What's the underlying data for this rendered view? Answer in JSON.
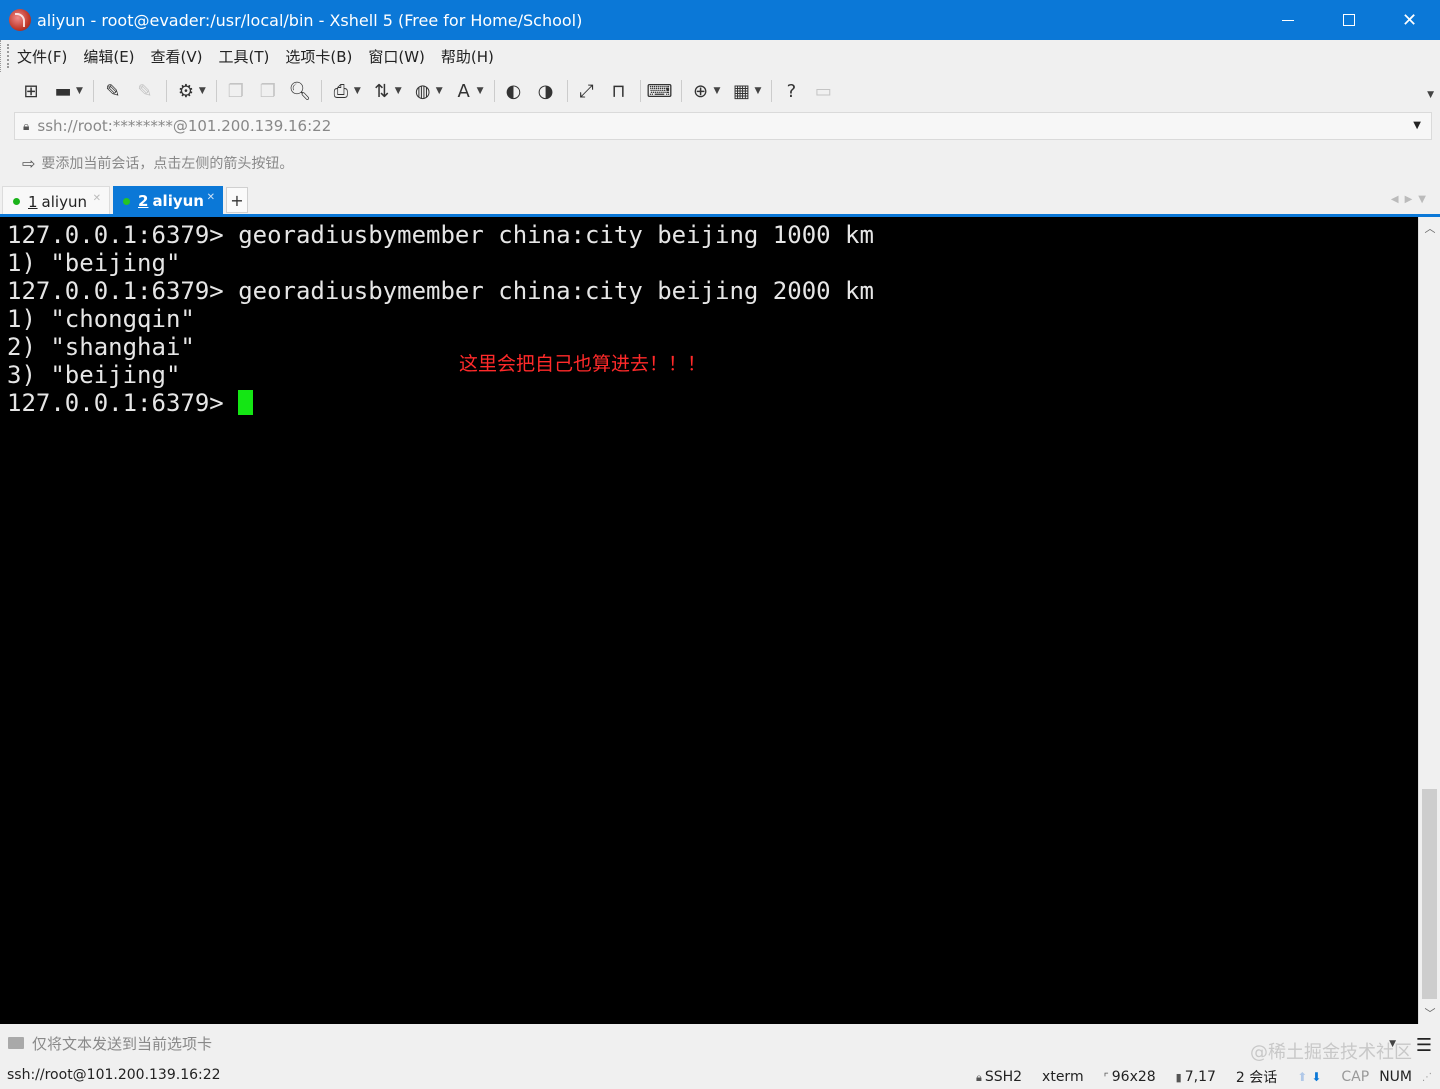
{
  "window": {
    "title": "aliyun - root@evader:/usr/local/bin - Xshell 5 (Free for Home/School)",
    "controls": {
      "minimize": "minimize",
      "maximize": "maximize",
      "close": "✕"
    }
  },
  "menu": [
    "文件(F)",
    "编辑(E)",
    "查看(V)",
    "工具(T)",
    "选项卡(B)",
    "窗口(W)",
    "帮助(H)"
  ],
  "toolbar": {
    "icons": [
      "new-session-icon",
      "open-folder-icon",
      "reconnect-icon",
      "disconnect-icon",
      "properties-icon",
      "copy-icon",
      "paste-icon",
      "find-icon",
      "print-icon",
      "transfer-icon",
      "globe-icon",
      "font-icon",
      "xftp-icon",
      "scripts-icon",
      "fullscreen-icon",
      "lock-icon",
      "keyboard-icon",
      "new-tab-icon",
      "layout-icon",
      "help-icon",
      "chat-icon"
    ]
  },
  "address": {
    "url": "ssh://root:********@101.200.139.16:22"
  },
  "hint": {
    "text": "要添加当前会话，点击左侧的箭头按钮。"
  },
  "tabs": [
    {
      "num": "1",
      "label": "aliyun",
      "active": false
    },
    {
      "num": "2",
      "label": "aliyun",
      "active": true
    }
  ],
  "tab_add": "+",
  "terminal": {
    "lines": [
      "127.0.0.1:6379> georadiusbymember china:city beijing 1000 km",
      "1) \"beijing\"",
      "127.0.0.1:6379> georadiusbymember china:city beijing 2000 km",
      "1) \"chongqin\"",
      "2) \"shanghai\"",
      "3) \"beijing\"",
      "127.0.0.1:6379> "
    ],
    "annotation": "这里会把自己也算进去！！！",
    "cursor_color": "#14e614",
    "background": "#000000"
  },
  "compose": {
    "text": "仅将文本发送到当前选项卡"
  },
  "watermark": "@稀土掘金技术社区",
  "status": {
    "connection": "ssh://root@101.200.139.16:22",
    "protocol": "SSH2",
    "terminal_type": "xterm",
    "size": "96x28",
    "position": "7,17",
    "sessions": "2 会话",
    "caps": "CAP",
    "num": "NUM"
  },
  "colors": {
    "accent": "#0b78d7",
    "annotation": "#ff2a2a"
  }
}
